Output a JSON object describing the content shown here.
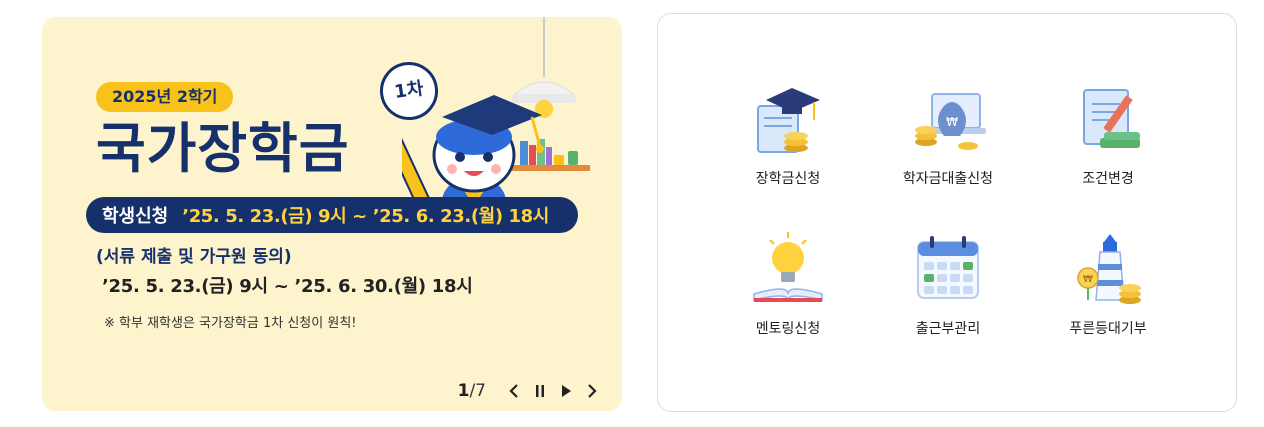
{
  "banner": {
    "semester": "2025년 2학기",
    "title": "국가장학금",
    "badge": "1차",
    "apply_label": "학생신청",
    "apply_date": "’25. 5. 23.(금) 9시 ~ ’25. 6. 23.(월) 18시",
    "doc_label": "(서류 제출 및 가구원 동의)",
    "doc_date": "’25. 5. 23.(금) 9시 ~ ’25. 6. 30.(월) 18시",
    "note": "※ 학부 재학생은 국가장학금 1차 신청이 원칙!",
    "pager_current": "1",
    "pager_total": "/7"
  },
  "quick_menu": {
    "items": [
      {
        "label": "장학금신청",
        "icon": "graduation-cap-certificate-icon"
      },
      {
        "label": "학자금대출신청",
        "icon": "money-bag-laptop-icon"
      },
      {
        "label": "조건변경",
        "icon": "document-pen-icon"
      },
      {
        "label": "멘토링신청",
        "icon": "lightbulb-book-icon"
      },
      {
        "label": "출근부관리",
        "icon": "calendar-icon"
      },
      {
        "label": "푸른등대기부",
        "icon": "lighthouse-coins-icon"
      }
    ]
  },
  "colors": {
    "navy": "#16306b",
    "yellow": "#f9c21a",
    "banner_bg": "#fdf3cc",
    "date_yellow": "#ffd33d"
  }
}
